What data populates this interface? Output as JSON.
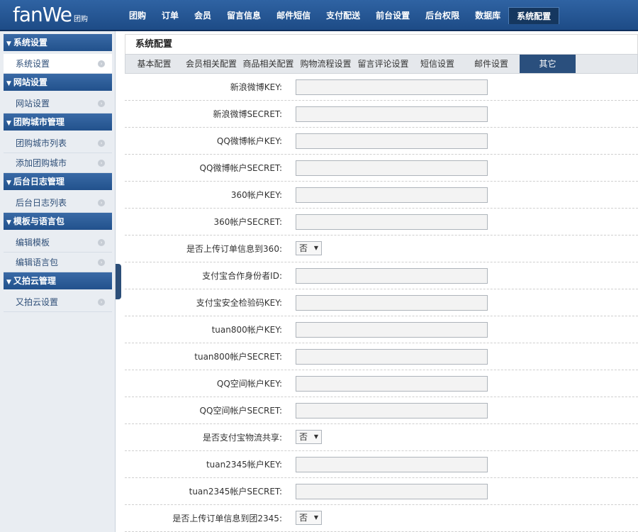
{
  "logo": {
    "main": "fanWe",
    "sub": "团购"
  },
  "nav": [
    "团购",
    "订单",
    "会员",
    "留言信息",
    "邮件短信",
    "支付配送",
    "前台设置",
    "后台权限",
    "数据库",
    "系统配置"
  ],
  "nav_active": "系统配置",
  "sidebar": {
    "sections": [
      {
        "title": "系统设置",
        "items": [
          "系统设置"
        ]
      },
      {
        "title": "网站设置",
        "items": [
          "网站设置"
        ]
      },
      {
        "title": "团购城市管理",
        "items": [
          "团购城市列表",
          "添加团购城市"
        ]
      },
      {
        "title": "后台日志管理",
        "items": [
          "后台日志列表"
        ]
      },
      {
        "title": "模板与语言包",
        "items": [
          "编辑模板",
          "编辑语言包"
        ]
      },
      {
        "title": "又拍云管理",
        "items": [
          "又拍云设置"
        ]
      }
    ],
    "selected": "系统设置"
  },
  "main": {
    "title": "系统配置",
    "tabs": [
      "基本配置",
      "会员相关配置",
      "商品相关配置",
      "购物流程设置",
      "留言评论设置",
      "短信设置",
      "邮件设置",
      "其它"
    ],
    "active_tab": "其它"
  },
  "rows": [
    {
      "label": "新浪微博KEY:",
      "type": "text",
      "value": ""
    },
    {
      "label": "新浪微博SECRET:",
      "type": "text",
      "value": ""
    },
    {
      "label": "QQ微博帐户KEY:",
      "type": "text",
      "value": ""
    },
    {
      "label": "QQ微博帐户SECRET:",
      "type": "text",
      "value": ""
    },
    {
      "label": "360帐户KEY:",
      "type": "text",
      "value": ""
    },
    {
      "label": "360帐户SECRET:",
      "type": "text",
      "value": ""
    },
    {
      "label": "是否上传订单信息到360:",
      "type": "select",
      "value": "否"
    },
    {
      "label": "支付宝合作身份者ID:",
      "type": "text",
      "value": ""
    },
    {
      "label": "支付宝安全检验码KEY:",
      "type": "text",
      "value": ""
    },
    {
      "label": "tuan800帐户KEY:",
      "type": "text",
      "value": ""
    },
    {
      "label": "tuan800帐户SECRET:",
      "type": "text",
      "value": ""
    },
    {
      "label": "QQ空间帐户KEY:",
      "type": "text",
      "value": ""
    },
    {
      "label": "QQ空间帐户SECRET:",
      "type": "text",
      "value": ""
    },
    {
      "label": "是否支付宝物流共享:",
      "type": "select",
      "value": "否"
    },
    {
      "label": "tuan2345帐户KEY:",
      "type": "text",
      "value": ""
    },
    {
      "label": "tuan2345帐户SECRET:",
      "type": "text",
      "value": ""
    },
    {
      "label": "是否上传订单信息到团2345:",
      "type": "select",
      "value": "否"
    }
  ],
  "colors": {
    "topbar": "#2f63a3",
    "accent": "#2a4f7d",
    "sidebar_bg": "#e9edf2"
  },
  "icons": {
    "section": "triangle-down-icon",
    "item": "chevron-right-icon",
    "select": "caret-down-icon"
  }
}
